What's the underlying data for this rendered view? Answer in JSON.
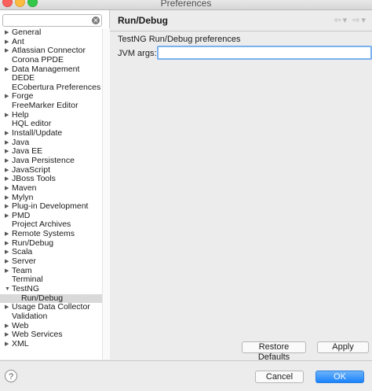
{
  "window": {
    "title": "Preferences"
  },
  "search": {
    "value": "",
    "placeholder": ""
  },
  "tree": [
    {
      "label": "General",
      "expandable": true
    },
    {
      "label": "Ant",
      "expandable": true
    },
    {
      "label": "Atlassian Connector",
      "expandable": true
    },
    {
      "label": "Corona PPDE",
      "expandable": false
    },
    {
      "label": "Data Management",
      "expandable": true
    },
    {
      "label": "DEDE",
      "expandable": false
    },
    {
      "label": "ECobertura Preferences",
      "expandable": false
    },
    {
      "label": "Forge",
      "expandable": true
    },
    {
      "label": "FreeMarker Editor",
      "expandable": false
    },
    {
      "label": "Help",
      "expandable": true
    },
    {
      "label": "HQL editor",
      "expandable": false
    },
    {
      "label": "Install/Update",
      "expandable": true
    },
    {
      "label": "Java",
      "expandable": true
    },
    {
      "label": "Java EE",
      "expandable": true
    },
    {
      "label": "Java Persistence",
      "expandable": true
    },
    {
      "label": "JavaScript",
      "expandable": true
    },
    {
      "label": "JBoss Tools",
      "expandable": true
    },
    {
      "label": "Maven",
      "expandable": true
    },
    {
      "label": "Mylyn",
      "expandable": true
    },
    {
      "label": "Plug-in Development",
      "expandable": true
    },
    {
      "label": "PMD",
      "expandable": true
    },
    {
      "label": "Project Archives",
      "expandable": false
    },
    {
      "label": "Remote Systems",
      "expandable": true
    },
    {
      "label": "Run/Debug",
      "expandable": true
    },
    {
      "label": "Scala",
      "expandable": true
    },
    {
      "label": "Server",
      "expandable": true
    },
    {
      "label": "Team",
      "expandable": true
    },
    {
      "label": "Terminal",
      "expandable": false
    },
    {
      "label": "TestNG",
      "expandable": true,
      "expanded": true
    },
    {
      "label": "Run/Debug",
      "child": true,
      "selected": true
    },
    {
      "label": "Usage Data Collector",
      "expandable": true
    },
    {
      "label": "Validation",
      "expandable": false
    },
    {
      "label": "Web",
      "expandable": true
    },
    {
      "label": "Web Services",
      "expandable": true
    },
    {
      "label": "XML",
      "expandable": true
    }
  ],
  "page": {
    "title": "Run/Debug",
    "description": "TestNG Run/Debug preferences",
    "jvm_label": "JVM args:",
    "jvm_value": "",
    "restore_label": "Restore Defaults",
    "apply_label": "Apply"
  },
  "footer": {
    "help_glyph": "?",
    "cancel_label": "Cancel",
    "ok_label": "OK"
  },
  "icons": {
    "collapsed_arrow": "▶",
    "expanded_arrow": "▼",
    "back": "⇦",
    "forward": "⇨"
  },
  "colors": {
    "accent": "#1a82fb",
    "selection": "#d9d9d9",
    "focus_ring": "#7ab1ef"
  }
}
